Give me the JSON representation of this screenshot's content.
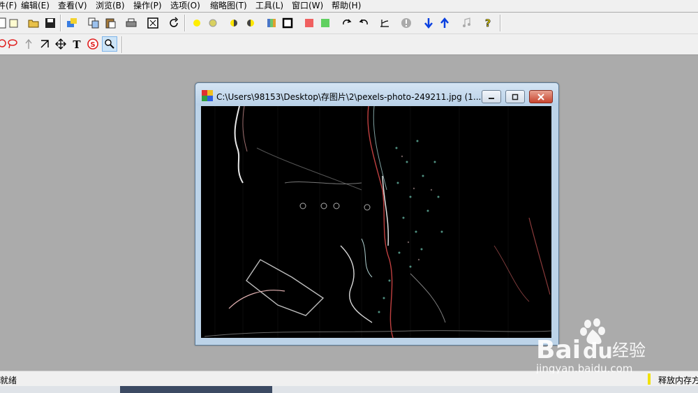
{
  "menu": {
    "items": [
      {
        "label": "件(F)"
      },
      {
        "label": "编辑(E)"
      },
      {
        "label": "查看(V)"
      },
      {
        "label": "浏览(B)"
      },
      {
        "label": "操作(P)"
      },
      {
        "label": "选项(O)"
      },
      {
        "label": "缩略图(T)"
      },
      {
        "label": "工具(L)"
      },
      {
        "label": "窗口(W)"
      },
      {
        "label": "帮助(H)"
      }
    ]
  },
  "toolbar1": {
    "icons": [
      "new-icon",
      "open-folder-icon",
      "save-icon",
      "browse-icon",
      "copy-icon",
      "paste-icon",
      "print-icon",
      "fit-window-icon",
      "undo-rotate-icon",
      "yellow-dot-icon",
      "gray-dot-icon",
      "half-yellow-icon",
      "half-yellow-2-icon",
      "color-balance-icon",
      "black-square-icon",
      "red-square-icon",
      "green-square-icon",
      "rotate-cw-icon",
      "rotate-ccw-icon",
      "curve-icon",
      "info-icon",
      "down-arrow-icon",
      "up-arrow-icon",
      "music-icon",
      "help-icon"
    ]
  },
  "toolbar2": {
    "icons": [
      "lasso-red-icon",
      "lasso-icon",
      "arrow-up-icon",
      "crop-icon",
      "move-icon",
      "text-icon",
      "stamp-icon",
      "zoom-icon"
    ]
  },
  "child_window": {
    "title": "C:\\Users\\98153\\Desktop\\存图片\\2\\pexels-photo-249211.jpg (1..."
  },
  "status": {
    "left": "就绪",
    "right": "释放内存方"
  },
  "watermark": {
    "brand": "Bai",
    "brand2": "du",
    "suffix": "经验",
    "url": "jingyan.baidu.com"
  },
  "colors": {
    "background": "#ababab",
    "toolbar": "#f0f0f0",
    "title_bar": "#c7dbee",
    "close_button": "#c8452f"
  }
}
